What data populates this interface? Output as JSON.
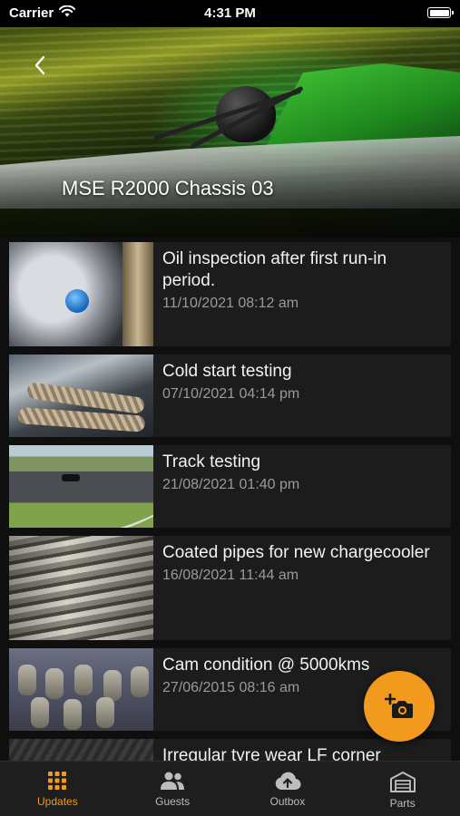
{
  "status_bar": {
    "carrier": "Carrier",
    "time": "4:31 PM"
  },
  "hero": {
    "title": "MSE R2000 Chassis 03"
  },
  "updates": [
    {
      "title": "Oil inspection after first run-in period.",
      "date": "11/10/2021 08:12 am",
      "thumb": "oil-inspection-photo"
    },
    {
      "title": "Cold start testing",
      "date": "07/10/2021 04:14 pm",
      "thumb": "engine-bay-photo"
    },
    {
      "title": "Track testing",
      "date": "21/08/2021 01:40 pm",
      "thumb": "track-photo"
    },
    {
      "title": "Coated pipes for new chargecooler",
      "date": "16/08/2021 11:44 am",
      "thumb": "coated-pipes-photo"
    },
    {
      "title": "Cam condition @ 5000kms",
      "date": "27/06/2015 08:16 am",
      "thumb": "camshaft-photo"
    },
    {
      "title": "Irregular tyre wear LF corner",
      "date": "",
      "thumb": "tyre-photo"
    }
  ],
  "fab": {
    "icon": "add-photo-icon"
  },
  "tabs": [
    {
      "label": "Updates",
      "icon": "grid-icon",
      "active": true
    },
    {
      "label": "Guests",
      "icon": "people-icon",
      "active": false
    },
    {
      "label": "Outbox",
      "icon": "cloud-upload-icon",
      "active": false
    },
    {
      "label": "Parts",
      "icon": "garage-icon",
      "active": false
    }
  ],
  "colors": {
    "accent": "#f29a1d",
    "card_bg": "#1c1c1c",
    "background": "#0f0f0f"
  }
}
